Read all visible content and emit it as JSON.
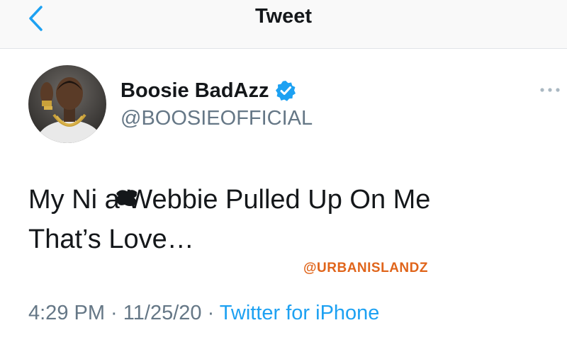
{
  "nav": {
    "title": "Tweet",
    "back_icon": "chevron-left-icon"
  },
  "tweet": {
    "display_name": "Boosie BadAzz",
    "handle": "@BOOSIEOFFICIAL",
    "verified": true,
    "text": "My Ni  a Webbie Pulled Up On Me\nThat’s Love…",
    "time": "4:29 PM",
    "separator": " · ",
    "date": "11/25/20",
    "source": "Twitter for iPhone"
  },
  "overlay": {
    "watermark": "@URBANISLANDZ"
  },
  "colors": {
    "accent": "#1da1f2",
    "secondary_text": "#657786",
    "watermark": "#e0651b"
  }
}
